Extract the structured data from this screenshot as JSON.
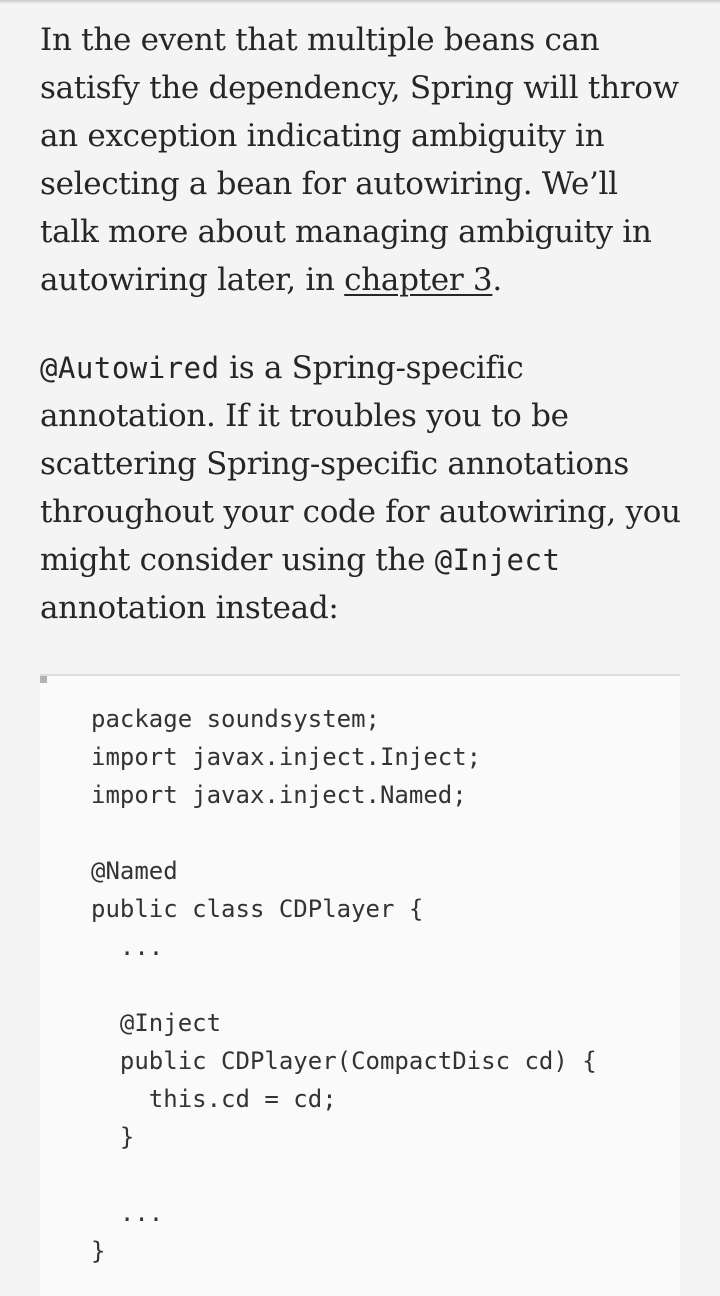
{
  "paragraph1": {
    "text_before_link": "In the event that multiple beans can satisfy the dependency, Spring will throw an exception indicating ambiguity in selecting a bean for autowiring. We’ll talk more about managing ambiguity in autowiring later, in ",
    "link_text": "chapter 3",
    "text_after_link": "."
  },
  "paragraph2": {
    "code1": "@Autowired",
    "text1": " is a Spring-specific annotation. If it troubles you to be scattering Spring-specific annotations throughout your code for autowiring, you might consider using the ",
    "code2": "@Inject",
    "text2": " annotation instead:"
  },
  "code_block": {
    "lines": [
      "package soundsystem;",
      "import javax.inject.Inject;",
      "import javax.inject.Named;",
      "",
      "@Named",
      "public class CDPlayer {",
      "  ...",
      "",
      "  @Inject",
      "  public CDPlayer(CompactDisc cd) {",
      "    this.cd = cd;",
      "  }",
      "",
      "  ...",
      "}"
    ]
  }
}
